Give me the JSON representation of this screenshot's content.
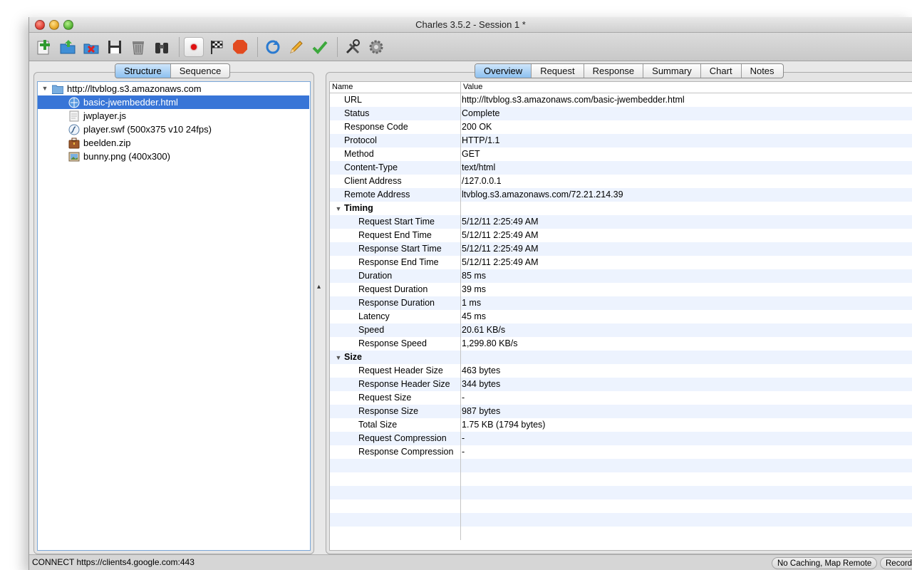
{
  "window": {
    "title": "Charles 3.5.2 - Session 1 *"
  },
  "toolbar": {
    "buttons": [
      {
        "name": "new-session",
        "icon": "add-icon"
      },
      {
        "name": "open-session",
        "icon": "open-folder-icon"
      },
      {
        "name": "close-session",
        "icon": "close-folder-icon"
      },
      {
        "name": "save-session",
        "icon": "floppy-icon"
      },
      {
        "name": "clear-session",
        "icon": "trash-icon"
      },
      {
        "name": "find",
        "icon": "binoculars-icon"
      },
      {
        "name": "record",
        "icon": "record-icon"
      },
      {
        "name": "throttle",
        "icon": "checkered-flag-icon"
      },
      {
        "name": "breakpoints",
        "icon": "stop-sign-icon"
      },
      {
        "name": "repeat",
        "icon": "refresh-icon"
      },
      {
        "name": "edit",
        "icon": "pencil-icon"
      },
      {
        "name": "validate",
        "icon": "checkmark-icon"
      },
      {
        "name": "tools",
        "icon": "tools-icon"
      },
      {
        "name": "settings",
        "icon": "gear-icon"
      }
    ]
  },
  "left_tabs": [
    "Structure",
    "Sequence"
  ],
  "left_active": "Structure",
  "tree": {
    "host": "http://ltvblog.s3.amazonaws.com",
    "items": [
      {
        "label": "basic-jwembedder.html",
        "icon": "html-file-icon",
        "selected": true
      },
      {
        "label": "jwplayer.js",
        "icon": "script-file-icon",
        "selected": false
      },
      {
        "label": "player.swf (500x375 v10 24fps)",
        "icon": "flash-file-icon",
        "selected": false
      },
      {
        "label": "beelden.zip",
        "icon": "archive-file-icon",
        "selected": false
      },
      {
        "label": "bunny.png (400x300)",
        "icon": "image-file-icon",
        "selected": false
      }
    ]
  },
  "right_tabs": [
    "Overview",
    "Request",
    "Response",
    "Summary",
    "Chart",
    "Notes"
  ],
  "right_active": "Overview",
  "table": {
    "headers": {
      "name": "Name",
      "value": "Value"
    },
    "rows": [
      {
        "name": "URL",
        "value": "http://ltvblog.s3.amazonaws.com/basic-jwembedder.html",
        "level": 0
      },
      {
        "name": "Status",
        "value": "Complete",
        "level": 0
      },
      {
        "name": "Response Code",
        "value": "200 OK",
        "level": 0
      },
      {
        "name": "Protocol",
        "value": "HTTP/1.1",
        "level": 0
      },
      {
        "name": "Method",
        "value": "GET",
        "level": 0
      },
      {
        "name": "Content-Type",
        "value": "text/html",
        "level": 0
      },
      {
        "name": "Client Address",
        "value": "/127.0.0.1",
        "level": 0
      },
      {
        "name": "Remote Address",
        "value": "ltvblog.s3.amazonaws.com/72.21.214.39",
        "level": 0
      },
      {
        "name": "Timing",
        "value": "",
        "level": "group"
      },
      {
        "name": "Request Start Time",
        "value": "5/12/11 2:25:49 AM",
        "level": 1
      },
      {
        "name": "Request End Time",
        "value": "5/12/11 2:25:49 AM",
        "level": 1
      },
      {
        "name": "Response Start Time",
        "value": "5/12/11 2:25:49 AM",
        "level": 1
      },
      {
        "name": "Response End Time",
        "value": "5/12/11 2:25:49 AM",
        "level": 1
      },
      {
        "name": "Duration",
        "value": "85 ms",
        "level": 1
      },
      {
        "name": "Request Duration",
        "value": "39 ms",
        "level": 1
      },
      {
        "name": "Response Duration",
        "value": "1 ms",
        "level": 1
      },
      {
        "name": "Latency",
        "value": "45 ms",
        "level": 1
      },
      {
        "name": "Speed",
        "value": "20.61 KB/s",
        "level": 1
      },
      {
        "name": "Response Speed",
        "value": "1,299.80 KB/s",
        "level": 1
      },
      {
        "name": "Size",
        "value": "",
        "level": "group"
      },
      {
        "name": "Request Header Size",
        "value": "463 bytes",
        "level": 1
      },
      {
        "name": "Response Header Size",
        "value": "344 bytes",
        "level": 1
      },
      {
        "name": "Request Size",
        "value": "-",
        "level": 1
      },
      {
        "name": "Response Size",
        "value": "987 bytes",
        "level": 1
      },
      {
        "name": "Total Size",
        "value": "1.75 KB (1794 bytes)",
        "level": 1
      },
      {
        "name": "Request Compression",
        "value": "-",
        "level": 1
      },
      {
        "name": "Response Compression",
        "value": "-",
        "level": 1
      }
    ]
  },
  "statusbar": {
    "text": "CONNECT https://clients4.google.com:443",
    "badge1": "No Caching, Map Remote",
    "badge2": "Recording"
  },
  "colors": {
    "selection": "#3875d7",
    "active_tab": "#8cc0f0",
    "stripe": "#edf3fe"
  }
}
